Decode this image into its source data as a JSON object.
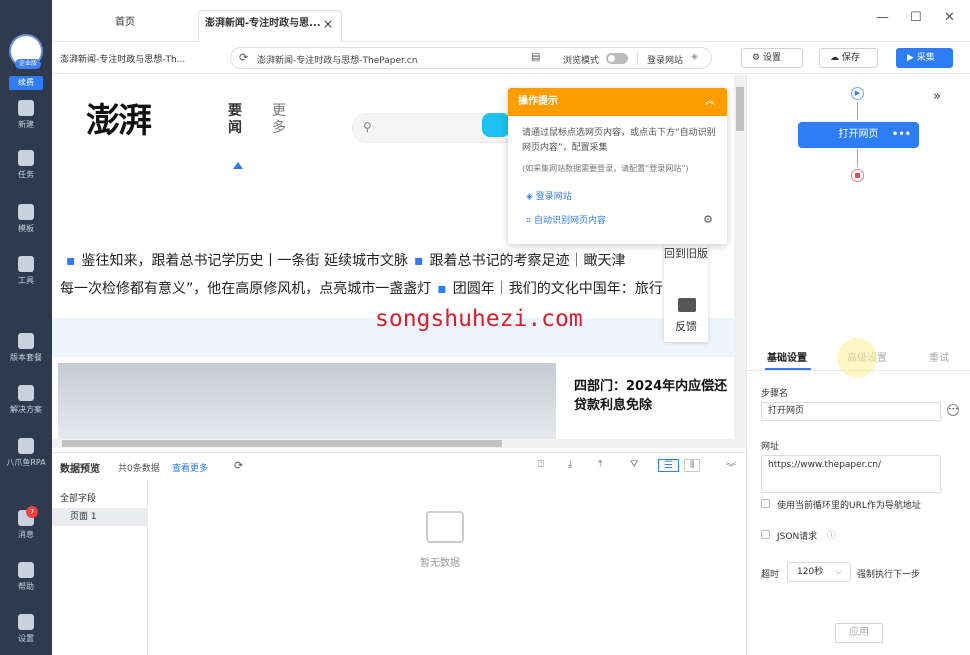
{
  "sidebar": {
    "avatar_badge": "企业版",
    "renew_label": "续费",
    "items": [
      {
        "label": "新建",
        "icon": "plus-icon"
      },
      {
        "label": "任务",
        "icon": "task-icon"
      },
      {
        "label": "模板",
        "icon": "template-icon"
      },
      {
        "label": "工具",
        "icon": "toolbox-icon"
      },
      {
        "label": "版本套餐",
        "icon": "crown-icon"
      },
      {
        "label": "解决方案",
        "icon": "solution-icon"
      },
      {
        "label": "八爪鱼RPA",
        "icon": "rpa-icon"
      },
      {
        "label": "消息",
        "icon": "bell-icon",
        "badge": "7"
      },
      {
        "label": "帮助",
        "icon": "help-icon"
      },
      {
        "label": "设置",
        "icon": "gear-icon"
      }
    ]
  },
  "tabs": {
    "home": "首页",
    "active": "澎湃新闻-专注时政与思...",
    "close": "×"
  },
  "window": {
    "minimize": "—",
    "maximize": "☐",
    "close": "✕"
  },
  "addressbar": {
    "page_title": "澎湃新闻-专注时政与思想-Th...",
    "url": "澎湃新闻-专注时政与思想-ThePaper.cn",
    "browse_mode": "浏览模式",
    "login_site": "登录网站"
  },
  "toolbar": {
    "settings": "设置",
    "save": "保存",
    "collect": "采集"
  },
  "webpage": {
    "logo": "澎湃",
    "nav_yaowen": "要闻",
    "nav_more": "更多",
    "news_line1": [
      "鉴往知来，跟着总书记学历史丨一条街 延续城市文脉",
      "跟着总书记的考察足迹｜瞰天津"
    ],
    "news_line2": [
      "每一次检修都有意义”，他在高原修风机，点亮城市一盏盏灯",
      "团圆年｜我们的文化中国年：旅行團"
    ],
    "back_top": "回到旧版",
    "feedback": "反馈",
    "headline": "四部门：2024年内应偿还贷款利息免除"
  },
  "tip": {
    "title": "操作提示",
    "body": "请通过鼠标点选网页内容，或点击下方“自动识别网页内容”，配置采集",
    "note": "(如采集网站数据需要登录，请配置“登录网站”)",
    "login": "登录网站",
    "auto": "自动识别网页内容"
  },
  "watermark": "songshuhezi.com",
  "preview": {
    "title": "数据预览",
    "count": "共0条数据",
    "more": "查看更多",
    "all_fields": "全部字段",
    "page1": "页面 1",
    "empty": "暂无数据"
  },
  "flow": {
    "node": "打开网页",
    "dots": "•••"
  },
  "panel": {
    "tabs": [
      "基础设置",
      "高级设置",
      "重试"
    ],
    "step_name_label": "步骤名",
    "step_name_value": "打开网页",
    "url_label": "网址",
    "url_value": "https://www.thepaper.cn/",
    "loop_url_label": "使用当前循环里的URL作为导航地址",
    "json_label": "JSON请求",
    "timeout_label": "超时",
    "timeout_value": "120秒",
    "force_next": "强制执行下一步",
    "apply": "应用"
  }
}
